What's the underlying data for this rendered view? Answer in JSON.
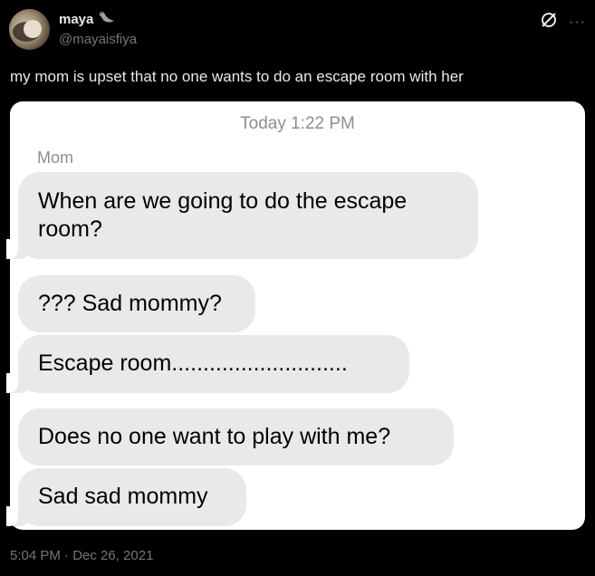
{
  "author": {
    "name": "maya",
    "handle": "@mayaisfiya",
    "name_emoji": "seal-icon"
  },
  "tweet": {
    "text": "my mom is upset that no one wants to do an escape room with her",
    "posted_at": "5:04 PM · Dec 26, 2021"
  },
  "screenshot": {
    "date_header": "Today 1:22 PM",
    "sender": "Mom",
    "messages": [
      "When are we going to do the escape room?",
      "??? Sad mommy?",
      "Escape room............................",
      "Does no one want to play with me?",
      "Sad sad mommy"
    ]
  },
  "icons": {
    "grok": "grok-slash-icon",
    "more": "more-dots-icon"
  },
  "colors": {
    "background": "#000000",
    "primary_text": "#e7e9ea",
    "secondary_text": "#71767b",
    "card_bg": "#ffffff",
    "bubble_bg": "#e9e9eb",
    "imessage_meta": "#8e8e93"
  }
}
